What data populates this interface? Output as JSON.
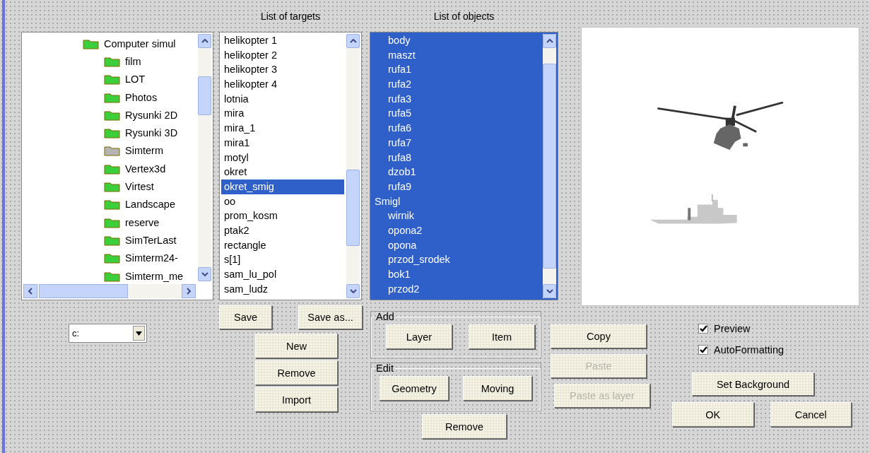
{
  "tree": {
    "items": [
      {
        "label": "Computer simul",
        "color": "#3ccf3c",
        "children": [
          {
            "label": "film",
            "color": "#3ccf3c"
          },
          {
            "label": "LOT",
            "color": "#3ccf3c"
          },
          {
            "label": "Photos",
            "color": "#3ccf3c"
          },
          {
            "label": "Rysunki 2D",
            "color": "#3ccf3c"
          },
          {
            "label": "Rysunki 3D",
            "color": "#3ccf3c"
          },
          {
            "label": "Simterm",
            "color": "#b4b4b4"
          },
          {
            "label": "Vertex3d",
            "color": "#3ccf3c"
          },
          {
            "label": "Virtest",
            "color": "#3ccf3c"
          },
          {
            "label": "Landscape",
            "color": "#3ccf3c"
          },
          {
            "label": "reserve",
            "color": "#3ccf3c"
          },
          {
            "label": "SimTerLast",
            "color": "#3ccf3c"
          },
          {
            "label": "Simterm24-",
            "color": "#3ccf3c"
          },
          {
            "label": "Simterm_me",
            "color": "#3ccf3c"
          }
        ]
      }
    ]
  },
  "drive": {
    "value": "c:"
  },
  "targets": {
    "title": "List of targets",
    "items": [
      {
        "label": "helikopter 1",
        "selected": false
      },
      {
        "label": "helikopter 2",
        "selected": false
      },
      {
        "label": "helikopter 3",
        "selected": false
      },
      {
        "label": "helikopter 4",
        "selected": false
      },
      {
        "label": "lotnia",
        "selected": false
      },
      {
        "label": "mira",
        "selected": false
      },
      {
        "label": "mira_1",
        "selected": false
      },
      {
        "label": "mira1",
        "selected": false
      },
      {
        "label": "motyl",
        "selected": false
      },
      {
        "label": "okret",
        "selected": false
      },
      {
        "label": "okret_smig",
        "selected": true
      },
      {
        "label": "oo",
        "selected": false
      },
      {
        "label": "prom_kosm",
        "selected": false
      },
      {
        "label": "ptak2",
        "selected": false
      },
      {
        "label": "rectangle",
        "selected": false
      },
      {
        "label": "s[1]",
        "selected": false
      },
      {
        "label": "sam_lu_pol",
        "selected": false
      },
      {
        "label": "sam_ludz",
        "selected": false
      }
    ]
  },
  "objects": {
    "title": "List of objects",
    "groups": [
      {
        "children": [
          {
            "label": "body",
            "selected": true
          },
          {
            "label": "maszt",
            "selected": true
          },
          {
            "label": "rufa1",
            "selected": true
          },
          {
            "label": "rufa2",
            "selected": true
          },
          {
            "label": "rufa3",
            "selected": true
          },
          {
            "label": "rufa5",
            "selected": true
          },
          {
            "label": "rufa6",
            "selected": true
          },
          {
            "label": "rufa7",
            "selected": true
          },
          {
            "label": "rufa8",
            "selected": true
          },
          {
            "label": "dzob1",
            "selected": true
          },
          {
            "label": "rufa9",
            "selected": true
          }
        ]
      },
      {
        "label": "Smigl",
        "selected": true,
        "children": [
          {
            "label": "wirnik",
            "selected": true
          },
          {
            "label": "opona2",
            "selected": true
          },
          {
            "label": "opona",
            "selected": true
          },
          {
            "label": "przod_srodek",
            "selected": true
          },
          {
            "label": "bok1",
            "selected": true
          },
          {
            "label": "przod2",
            "selected": true
          }
        ]
      }
    ]
  },
  "target_buttons": {
    "save": "Save",
    "save_as": "Save as...",
    "new": "New",
    "remove": "Remove",
    "import": "Import"
  },
  "add_group": {
    "title": "Add",
    "buttons": [
      "Layer",
      "Item"
    ]
  },
  "edit_group": {
    "title": "Edit",
    "buttons": [
      "Geometry",
      "Moving"
    ]
  },
  "remove_button": "Remove",
  "clipboard_buttons": [
    {
      "label": "Copy",
      "disabled": false
    },
    {
      "label": "Paste",
      "disabled": true
    },
    {
      "label": "Paste as layer",
      "disabled": true
    }
  ],
  "options": [
    {
      "label": "Preview",
      "checked": true
    },
    {
      "label": "AutoFormatting",
      "checked": true
    }
  ],
  "set_background": "Set Background",
  "dialog_buttons": [
    "OK",
    "Cancel"
  ]
}
